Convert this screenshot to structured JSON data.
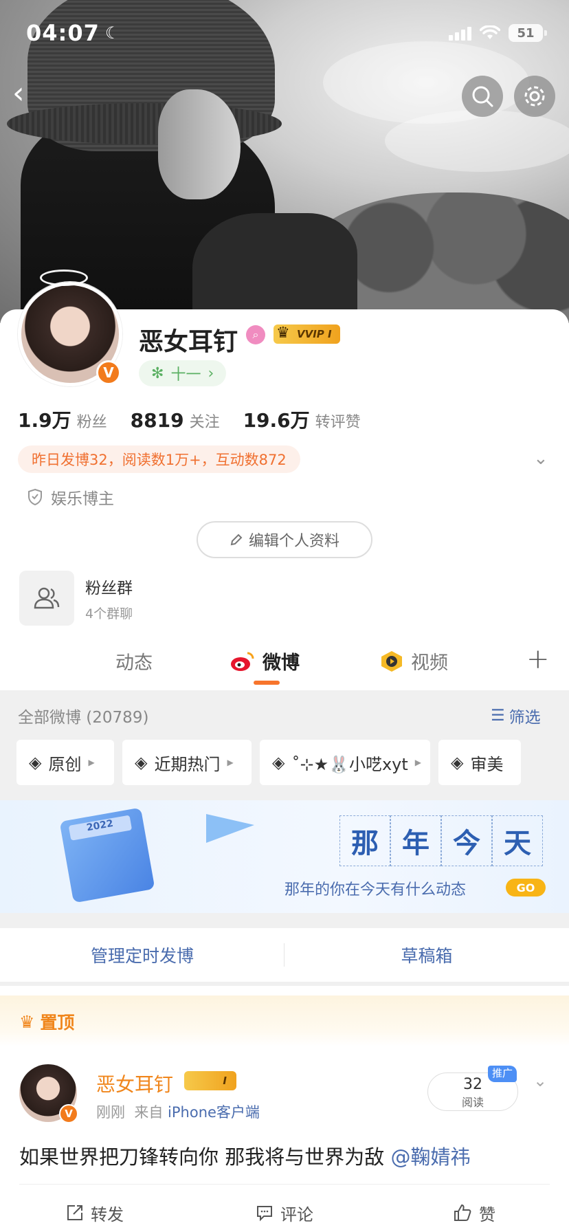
{
  "status": {
    "time": "04:07",
    "battery": "51"
  },
  "profile": {
    "name": "恶女耳钉",
    "vip_label": "VVIP I",
    "level_label": "十一",
    "stats": [
      {
        "value": "1.9万",
        "label": "粉丝"
      },
      {
        "value": "8819",
        "label": "关注"
      },
      {
        "value": "19.6万",
        "label": "转评赞"
      }
    ],
    "summary": "昨日发博32，阅读数1万+，互动数872",
    "tagline": "娱乐博主",
    "edit_label": "编辑个人资料",
    "fans_group": {
      "title": "粉丝群",
      "subtitle": "4个群聊"
    }
  },
  "tabs": [
    {
      "label": "动态"
    },
    {
      "label": "微博"
    },
    {
      "label": "视频"
    }
  ],
  "feed": {
    "all_label": "全部微博 (20789)",
    "filter_label": "筛选",
    "chips": [
      "原创",
      "近期热门",
      "˚⊹★🐰小呓xyt",
      "审美"
    ],
    "banner": {
      "title_chars": [
        "那",
        "年",
        "今",
        "天"
      ],
      "subtitle": "那年的你在今天有什么动态",
      "go": "GO",
      "calendar_year": "2022"
    },
    "actions": [
      "管理定时发博",
      "草稿箱"
    ]
  },
  "pinned": {
    "label": "置顶",
    "author": "恶女耳钉",
    "vip_label": "I",
    "time": "刚刚",
    "source_prefix": "来自",
    "source": "iPhone客户端",
    "reads": "32",
    "reads_label": "阅读",
    "promo": "推广",
    "text": "如果世界把刀锋转向你 那我将与世界为敌",
    "mention": "@鞠婧祎",
    "buttons": [
      "转发",
      "评论",
      "赞"
    ]
  },
  "colors": {
    "accent": "#f7752c",
    "link": "#4a6cae",
    "vip_gold": "#f0a21e",
    "summary_text": "#f07030"
  }
}
